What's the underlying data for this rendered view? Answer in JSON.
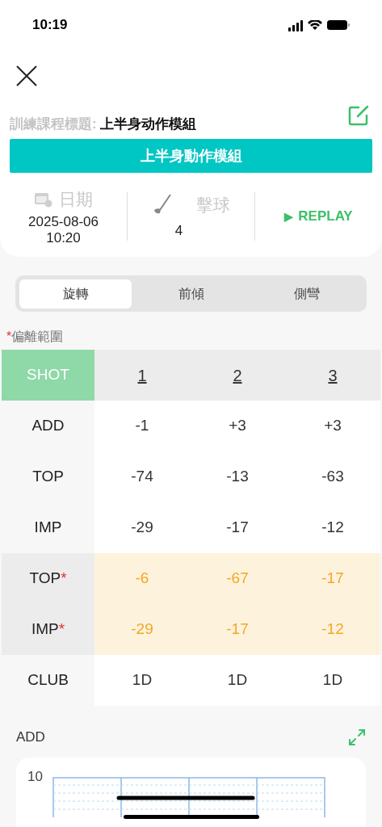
{
  "status_bar": {
    "time": "10:19"
  },
  "course": {
    "label": "訓練課程標題:",
    "value": "上半身动作模組"
  },
  "module_button": "上半身動作模組",
  "info": {
    "date_label": "日期",
    "date": "2025-08-06",
    "time": "10:20",
    "shots_label": "擊球",
    "shots": "4",
    "replay": "REPLAY",
    "replay_icon": "▶"
  },
  "tabs": [
    {
      "label": "旋轉",
      "selected": true
    },
    {
      "label": "前傾",
      "selected": false
    },
    {
      "label": "側彎",
      "selected": false
    }
  ],
  "legend": {
    "mark": "*",
    "label": "偏離範圍"
  },
  "table": {
    "header": [
      "SHOT",
      "1",
      "2",
      "3"
    ],
    "rows": [
      {
        "label": "ADD",
        "deviation": false,
        "cells": [
          "-1",
          "+3",
          "+3"
        ]
      },
      {
        "label": "TOP",
        "deviation": false,
        "cells": [
          "-74",
          "-13",
          "-63"
        ]
      },
      {
        "label": "IMP",
        "deviation": false,
        "cells": [
          "-29",
          "-17",
          "-12"
        ]
      },
      {
        "label": "TOP",
        "deviation": true,
        "mark": "*",
        "cells": [
          "-6",
          "-67",
          "-17"
        ]
      },
      {
        "label": "IMP",
        "deviation": true,
        "mark": "*",
        "cells": [
          "-29",
          "-17",
          "-12"
        ]
      },
      {
        "label": "CLUB",
        "deviation": false,
        "cells": [
          "1D",
          "1D",
          "1D"
        ]
      }
    ]
  },
  "chart": {
    "title": "ADD",
    "y_tick": "10"
  }
}
